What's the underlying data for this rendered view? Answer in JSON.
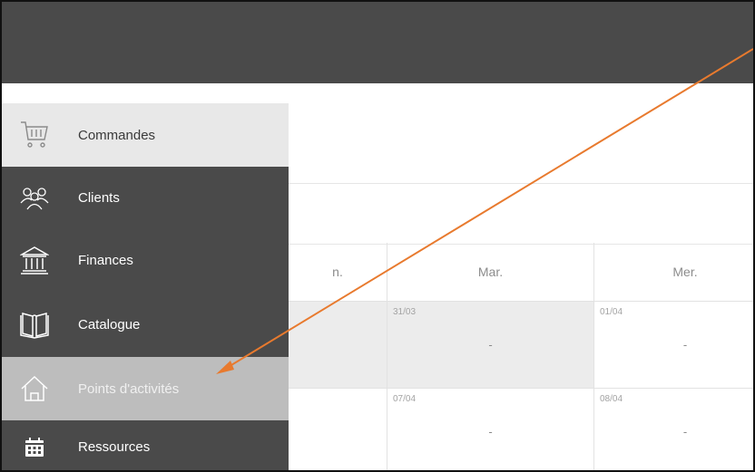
{
  "sidebar": {
    "items": [
      {
        "label": "Commandes",
        "icon": "cart-icon",
        "state": "selected"
      },
      {
        "label": "Clients",
        "icon": "users-icon",
        "state": "normal"
      },
      {
        "label": "Finances",
        "icon": "bank-icon",
        "state": "normal"
      },
      {
        "label": "Catalogue",
        "icon": "book-icon",
        "state": "normal"
      },
      {
        "label": "Points d'activités",
        "icon": "home-icon",
        "state": "hover"
      },
      {
        "label": "Ressources",
        "icon": "calendar-icon",
        "state": "normal"
      }
    ]
  },
  "calendar": {
    "headers": [
      "n.",
      "Mar.",
      "Mer."
    ],
    "rows": [
      [
        {
          "date": "",
          "value": ""
        },
        {
          "date": "31/03",
          "value": "-"
        },
        {
          "date": "01/04",
          "value": "-"
        }
      ],
      [
        {
          "date": "",
          "value": ""
        },
        {
          "date": "07/04",
          "value": "-"
        },
        {
          "date": "08/04",
          "value": "-"
        }
      ]
    ]
  },
  "colors": {
    "header_bg": "#4a4a4a",
    "selected_bg": "#e8e8e8",
    "hover_bg": "#bdbdbd",
    "arrow": "#e87a2e"
  }
}
